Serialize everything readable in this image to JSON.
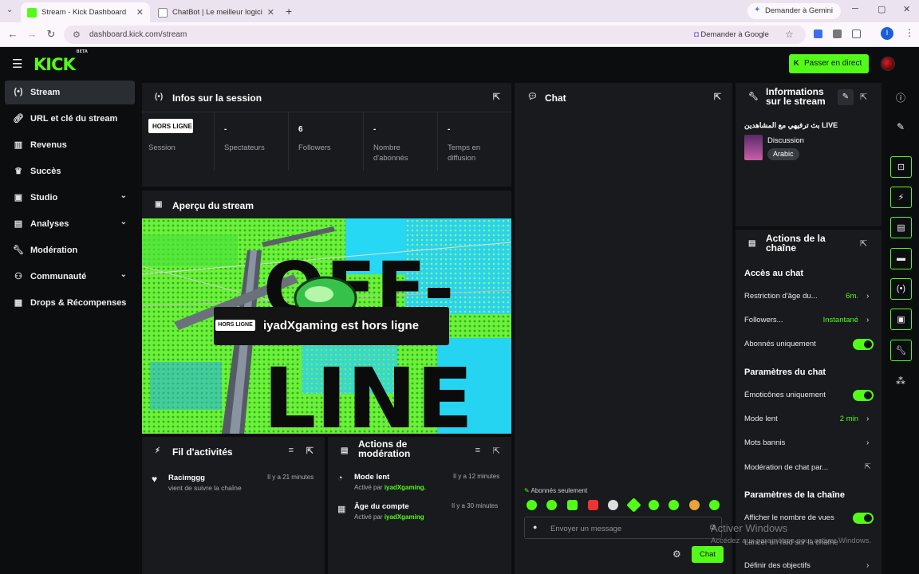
{
  "browser": {
    "tabs": [
      {
        "title": "Stream - Kick Dashboard",
        "active": true
      },
      {
        "title": "ChatBot | Le meilleur logiciel p...",
        "active": false
      }
    ],
    "url": "dashboard.kick.com/stream",
    "gemini_label": "Demander à Gemini",
    "google_label": "Demander à Google",
    "profile_initial": "I"
  },
  "header": {
    "logo": "KICK",
    "logo_badge": "BETA",
    "go_live_label": "Passer en direct"
  },
  "sidebar": {
    "items": [
      {
        "label": "Stream",
        "icon": "broadcast-icon",
        "active": true
      },
      {
        "label": "URL et clé du stream",
        "icon": "link-icon"
      },
      {
        "label": "Revenus",
        "icon": "bar-chart-icon"
      },
      {
        "label": "Succès",
        "icon": "trophy-icon"
      },
      {
        "label": "Studio",
        "icon": "studio-icon",
        "expandable": true
      },
      {
        "label": "Analyses",
        "icon": "analytics-icon",
        "expandable": true
      },
      {
        "label": "Modération",
        "icon": "wrench-icon"
      },
      {
        "label": "Communauté",
        "icon": "community-icon",
        "expandable": true
      },
      {
        "label": "Drops & Récompenses",
        "icon": "gift-icon"
      }
    ]
  },
  "session": {
    "title": "Infos sur la session",
    "badge": "HORS LIGNE",
    "badge_label": "Session",
    "stats": [
      {
        "value": "-",
        "label": "Spectateurs"
      },
      {
        "value": "6",
        "label": "Followers"
      },
      {
        "value": "-",
        "label": "Nombre d'abonnés"
      },
      {
        "value": "-",
        "label": "Temps en diffusion"
      }
    ]
  },
  "preview": {
    "title": "Aperçu du stream",
    "offline_badge": "HORS LIGNE",
    "offline_message": "iyadXgaming est hors ligne",
    "art_word_1": "OFF-",
    "art_word_2": "LINE"
  },
  "activity": {
    "title": "Fil d'activités",
    "items": [
      {
        "user": "Racimggg",
        "text": "vient de suivre la chaîne",
        "time": "Il y a 21 minutes"
      }
    ]
  },
  "modactions": {
    "title": "Actions de modération",
    "items": [
      {
        "action": "Mode lent",
        "by_label": "Activé par",
        "by_user": "iyadXgaming.",
        "time": "Il y a 12 minutes"
      },
      {
        "action": "Âge du compte",
        "by_label": "Activé par",
        "by_user": "iyadXgaming",
        "time": "Il y a 30 minutes"
      }
    ]
  },
  "chat": {
    "title": "Chat",
    "subscribers_only": "Abonnés seulement",
    "input_placeholder": "Envoyer un message",
    "send_label": "Chat"
  },
  "stream_info": {
    "title": "Informations sur le stream",
    "stream_title": "بث ترفيهي مع المشاهدين LIVE",
    "category": "Discussion",
    "language": "Arabic"
  },
  "channel_actions": {
    "title": "Actions de la chaîne",
    "chat_access_heading": "Accès au chat",
    "age_restriction": {
      "label": "Restriction d'âge du...",
      "value": "6m."
    },
    "followers": {
      "label": "Followers...",
      "value": "Instantané"
    },
    "subscribers_only": {
      "label": "Abonnés uniquement",
      "enabled": true
    },
    "chat_params_heading": "Paramètres du chat",
    "emotes_only": {
      "label": "Émoticônes uniquement",
      "enabled": true
    },
    "slow_mode": {
      "label": "Mode lent",
      "value": "2 min"
    },
    "banned_words": {
      "label": "Mots bannis"
    },
    "chat_moderation": {
      "label": "Modération de chat par..."
    },
    "channel_params_heading": "Paramètres de la chaîne",
    "show_views": {
      "label": "Afficher le nombre de vues",
      "enabled": true
    },
    "launch_raid": {
      "label": "Lancer un raid sur la chaîne"
    },
    "define_goals": {
      "label": "Définir des objectifs"
    }
  },
  "watermark": {
    "title": "Activer Windows",
    "subtitle": "Accédez aux paramètres pour activer Windows."
  },
  "colors": {
    "accent": "#53fc18",
    "panel": "#181a1d",
    "background": "#0b0d0f"
  }
}
